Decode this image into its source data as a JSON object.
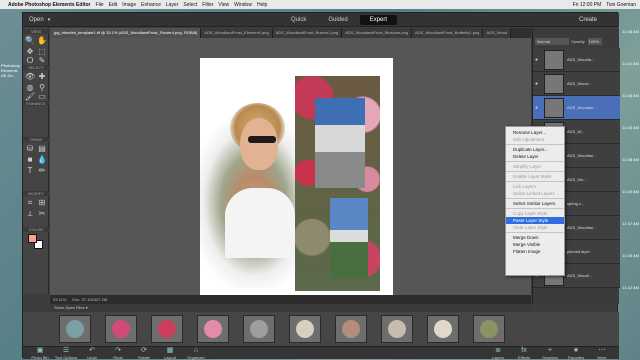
{
  "macbar": {
    "apple": "",
    "app": "Adobe Photoshop Elements Editor",
    "menus": [
      "File",
      "Edit",
      "Image",
      "Enhance",
      "Layer",
      "Select",
      "Filter",
      "View",
      "Window",
      "Help"
    ],
    "clock": "Fri 12:00 PM",
    "user": "Toni Goeman"
  },
  "desktop": {
    "left_label": "Photoshop Elements AE-Do..",
    "right_labels": [
      "11:48 AM",
      "11:41 AM",
      "11:46 AM",
      "11:43 AM",
      "11:38 AM",
      "11:40 AM",
      "11:37 AM",
      "11:35 AM",
      "11:32 AM"
    ]
  },
  "topbar": {
    "open": "Open",
    "modes": [
      "Quick",
      "Guided",
      "Expert"
    ],
    "active_mode": "Expert",
    "create": "Create"
  },
  "tool_sections": [
    "VIEW",
    "SELECT",
    "ENHANCE",
    "DRAW",
    "MODIFY",
    "COLOR"
  ],
  "tools": [
    {
      "name": "zoom-tool-icon",
      "glyph": "🔍"
    },
    {
      "name": "hand-tool-icon",
      "glyph": "✋"
    },
    {
      "name": "move-tool-icon",
      "glyph": "✥"
    },
    {
      "name": "marquee-tool-icon",
      "glyph": "⬚"
    },
    {
      "name": "lasso-tool-icon",
      "glyph": "ⵔ"
    },
    {
      "name": "quick-select-icon",
      "glyph": "✎"
    },
    {
      "name": "eye-tool-icon",
      "glyph": "👁"
    },
    {
      "name": "spot-heal-icon",
      "glyph": "✚"
    },
    {
      "name": "sponge-icon",
      "glyph": "◍"
    },
    {
      "name": "clone-stamp-icon",
      "glyph": "⚲"
    },
    {
      "name": "brush-tool-icon",
      "glyph": "🖌"
    },
    {
      "name": "eraser-icon",
      "glyph": "▭"
    },
    {
      "name": "paint-bucket-icon",
      "glyph": "⛁"
    },
    {
      "name": "gradient-icon",
      "glyph": "▤"
    },
    {
      "name": "shape-tool-icon",
      "glyph": "■"
    },
    {
      "name": "blur-icon",
      "glyph": "💧"
    },
    {
      "name": "type-tool-icon",
      "glyph": "T"
    },
    {
      "name": "pencil-icon",
      "glyph": "✏"
    },
    {
      "name": "crop-tool-icon",
      "glyph": "⌗"
    },
    {
      "name": "recompose-icon",
      "glyph": "⊞"
    },
    {
      "name": "straighten-icon",
      "glyph": "⟂"
    },
    {
      "name": "cookie-cutter-icon",
      "glyph": "✂"
    }
  ],
  "colors": {
    "foreground": "#f4a48c",
    "background": "#ffffff",
    "accent": "#2f6de0",
    "layer_selected": "#4a6fb8"
  },
  "tabs": [
    ".jpg_blended_template1.tif @ 33.1% (ADS_WoodlandFrost_Flower4.png, RGB/8)",
    "ADS_WoodlandFrost_Element1.png",
    "ADS_WoodlandFrost_Branch1.png",
    "ADS_WoodlandFrost_Blossom.png",
    "ADS_WoodlandFrost_Butterfly1.png",
    "ADS_Wood"
  ],
  "status": {
    "zoom": "33.11%",
    "doc": "Doc: 37.1M/307.2M"
  },
  "bin": {
    "dropdown": "Show Open Files"
  },
  "taskbar": {
    "left": [
      "Photo Bin",
      "Tool Options",
      "Undo",
      "Redo",
      "Rotate",
      "Layout",
      "Organizer"
    ],
    "right": [
      "Layers",
      "Effects",
      "Graphics",
      "Favorites",
      "More"
    ]
  },
  "panel": {
    "blend_mode": "Normal",
    "opacity_label": "Opacity:",
    "opacity": "100%",
    "layers": [
      "ADS_Woodla...",
      "ADS_Wood...",
      "ADS_Woodlan...",
      "ADS_W...",
      "ADS_Woodlan...",
      "ADS_Wo...",
      "spring.c...",
      "ADS_Woodlan...",
      "pierced.layer",
      "ADS_Woodl...",
      "ADS_Wood..."
    ]
  },
  "context_menu": [
    {
      "label": "Rename Layer...",
      "state": "normal"
    },
    {
      "label": "Edit Adjustment",
      "state": "disabled"
    },
    {
      "sep": true
    },
    {
      "label": "Duplicate Layer...",
      "state": "normal"
    },
    {
      "label": "Delete Layer",
      "state": "normal"
    },
    {
      "sep": true
    },
    {
      "label": "Simplify Layer",
      "state": "disabled"
    },
    {
      "sep": true
    },
    {
      "label": "Enable Layer Mask",
      "state": "disabled"
    },
    {
      "sep": true
    },
    {
      "label": "Link Layers",
      "state": "disabled"
    },
    {
      "label": "Select Linked Layers",
      "state": "disabled"
    },
    {
      "sep": true
    },
    {
      "label": "Select Similar Layers",
      "state": "normal"
    },
    {
      "sep": true
    },
    {
      "label": "Copy Layer Style",
      "state": "disabled"
    },
    {
      "label": "Paste Layer Style",
      "state": "highlighted"
    },
    {
      "label": "Clear Layer Style",
      "state": "disabled"
    },
    {
      "sep": true
    },
    {
      "label": "Merge Down",
      "state": "normal"
    },
    {
      "label": "Merge Visible",
      "state": "normal"
    },
    {
      "label": "Flatten Image",
      "state": "normal"
    }
  ]
}
